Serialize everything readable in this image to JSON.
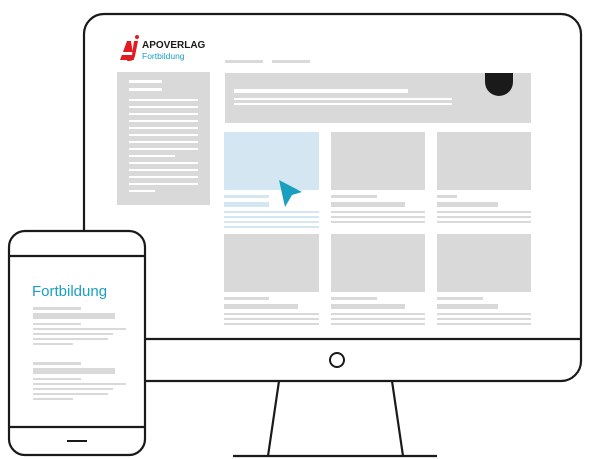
{
  "brand": {
    "name": "APOVERLAG",
    "subtitle": "Fortbildung",
    "logo_icon": "apoverlag-logo-icon"
  },
  "phone": {
    "title": "Fortbildung"
  },
  "colors": {
    "accent": "#1aa0bf",
    "logo_red": "#e11b22",
    "placeholder": "#d9d9d9",
    "highlight": "#d5e6f3",
    "outline": "#1a1a1a"
  },
  "icons": [
    "apoverlag-logo-icon",
    "mouse-cursor-icon",
    "power-button-icon",
    "home-button-icon"
  ]
}
